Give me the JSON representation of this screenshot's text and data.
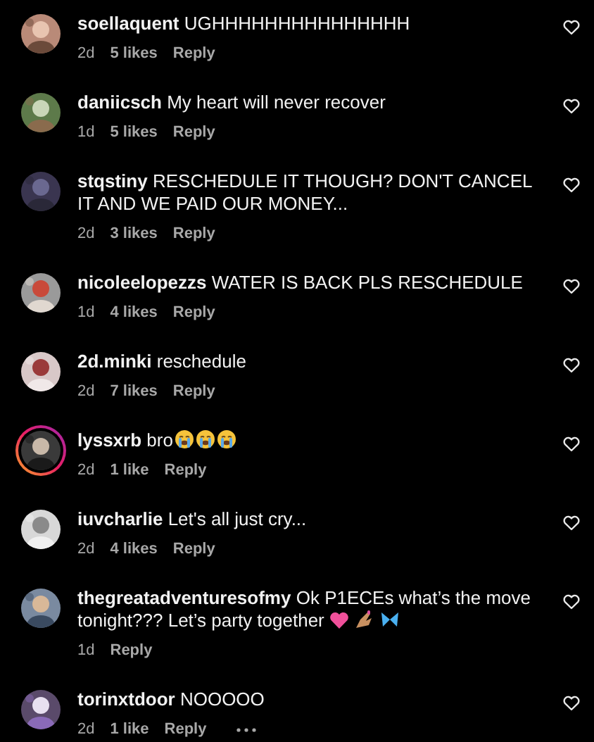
{
  "comments": [
    {
      "username": "soellaquent",
      "text": "UGHHHHHHHHHHHHHHH",
      "time": "2d",
      "likes": "5 likes",
      "reply": "Reply"
    },
    {
      "username": "daniicsch",
      "text": "My heart will never recover",
      "time": "1d",
      "likes": "5 likes",
      "reply": "Reply"
    },
    {
      "username": "stqstiny",
      "text": "RESCHEDULE IT THOUGH? DON'T CANCEL IT AND WE PAID OUR MONEY...",
      "time": "2d",
      "likes": "3 likes",
      "reply": "Reply"
    },
    {
      "username": "nicoleelopezzs",
      "text": "WATER IS BACK PLS RESCHEDULE",
      "time": "1d",
      "likes": "4 likes",
      "reply": "Reply"
    },
    {
      "username": "2d.minki",
      "text": "reschedule",
      "time": "2d",
      "likes": "7 likes",
      "reply": "Reply"
    },
    {
      "username": "lyssxrb",
      "text": "bro",
      "emoji": [
        {
          "kind": "crying"
        },
        {
          "kind": "crying"
        },
        {
          "kind": "crying"
        }
      ],
      "story": true,
      "time": "2d",
      "likes": "1 like",
      "reply": "Reply"
    },
    {
      "username": "iuvcharlie",
      "text": "Let's all just cry...",
      "time": "2d",
      "likes": "4 likes",
      "reply": "Reply"
    },
    {
      "username": "thegreatadventuresofmy",
      "text": "Ok P1ECEs what’s the move tonight??? Let’s party together",
      "emoji": [
        {
          "kind": "heart"
        },
        {
          "kind": "nails"
        },
        {
          "kind": "butterfly"
        }
      ],
      "time": "1d",
      "reply": "Reply"
    },
    {
      "username": "torinxtdoor",
      "text": "NOOOOO",
      "time": "2d",
      "likes": "1 like",
      "reply": "Reply",
      "more": true
    }
  ]
}
